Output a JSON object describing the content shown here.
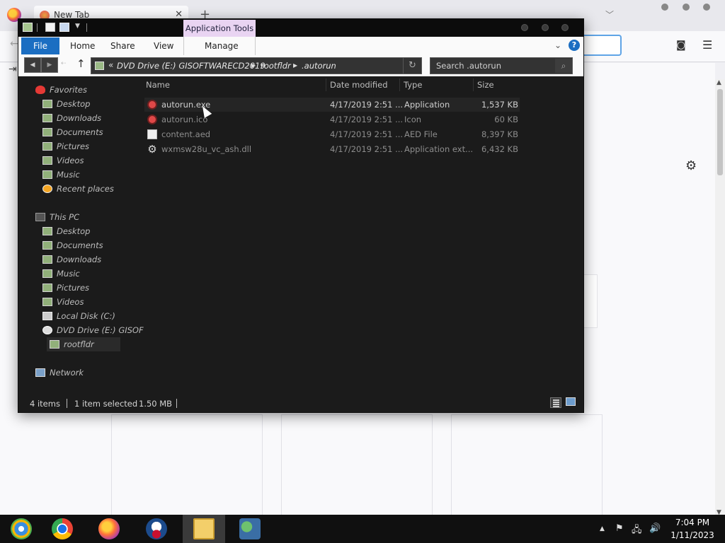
{
  "browser": {
    "tab_title": "New Tab",
    "tab_close": "✕",
    "new_tab": "+",
    "list_tabs": "﹀",
    "back": "←",
    "pocket_icon": "pocket-icon",
    "menu": "☰",
    "gear": "⚙",
    "sidebar_icon": "⇥",
    "scroll_up": "▲",
    "scroll_down": "▼"
  },
  "explorer": {
    "contextual_tab": "Application Tools",
    "ribbon": {
      "file": "File",
      "home": "Home",
      "share": "Share",
      "view": "View",
      "manage": "Manage",
      "expand": "⌄",
      "help": "?"
    },
    "nav": {
      "back": "◀",
      "forward": "▶",
      "recent": "⇠",
      "up": "↑",
      "chevron": "«",
      "crumbs": [
        "DVD Drive (E:) GISOFTWARECD2019",
        "rootfldr",
        ".autorun"
      ],
      "crumb_sep": "▶",
      "refresh": "↻",
      "search_placeholder": "Search .autorun",
      "search_icon": "⌕"
    },
    "nav_pane": {
      "favorites": "Favorites",
      "favorites_items": [
        "Desktop",
        "Downloads",
        "Documents",
        "Pictures",
        "Videos",
        "Music",
        "Recent places"
      ],
      "this_pc": "This PC",
      "this_pc_items": [
        "Desktop",
        "Documents",
        "Downloads",
        "Music",
        "Pictures",
        "Videos",
        "Local Disk (C:)",
        "DVD Drive (E:) GISOF"
      ],
      "selected_folder": "rootfldr",
      "network": "Network"
    },
    "columns": {
      "name": "Name",
      "date": "Date modified",
      "type": "Type",
      "size": "Size"
    },
    "files": [
      {
        "name": "autorun.exe",
        "date": "4/17/2019 2:51 ...",
        "type": "Application",
        "size": "1,537 KB",
        "icon": "app-icon"
      },
      {
        "name": "autorun.ico",
        "date": "4/17/2019 2:51 ...",
        "type": "Icon",
        "size": "60 KB",
        "icon": "icon-file-icon"
      },
      {
        "name": "content.aed",
        "date": "4/17/2019 2:51 ...",
        "type": "AED File",
        "size": "8,397 KB",
        "icon": "file-icon"
      },
      {
        "name": "wxmsw28u_vc_ash.dll",
        "date": "4/17/2019 2:51 ...",
        "type": "Application ext...",
        "size": "6,432 KB",
        "icon": "gear-icon"
      }
    ],
    "status": {
      "count": "4 items",
      "selected": "1 item selected",
      "size": "1.50 MB"
    }
  },
  "taskbar": {
    "tray_arrow": "▲",
    "tray_flag": "⚑",
    "tray_network": "🖧",
    "tray_volume": "🔊",
    "time": "7:04 PM",
    "date": "1/11/2023"
  }
}
